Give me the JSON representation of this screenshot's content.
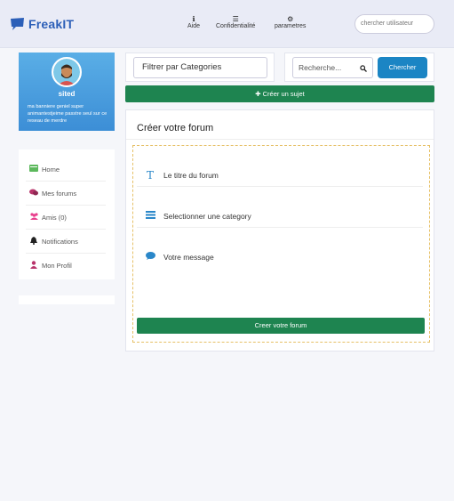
{
  "brand": {
    "name": "FreakIT",
    "color": "#2c5fb8"
  },
  "nav": {
    "items": [
      {
        "icon": "info-icon",
        "label": "Aide"
      },
      {
        "icon": "list-icon",
        "label": "Confidentialité"
      },
      {
        "icon": "gear-icon",
        "label": "parametres"
      }
    ],
    "user_search_placeholder": "chercher utilisateur"
  },
  "profile": {
    "name": "sited",
    "bio": "ma banniere geniel super animantestjeime passtre seul sur ce reseau de merdre"
  },
  "sidebar": {
    "items": [
      {
        "icon": "home-icon",
        "label": "Home"
      },
      {
        "icon": "comments-icon",
        "label": "Mes forums"
      },
      {
        "icon": "users-icon",
        "label": "Amis (0)"
      },
      {
        "icon": "bell-icon",
        "label": "Notifications"
      },
      {
        "icon": "user-icon",
        "label": "Mon Profil"
      }
    ]
  },
  "toolbar": {
    "filter_placeholder": "Filtrer par Categories",
    "search_placeholder": "Recherche...",
    "search_button": "Chercher",
    "create_topic": "✚ Créer un sujet"
  },
  "forum_form": {
    "heading": "Créer votre forum",
    "title_placeholder": "Le titre du forum",
    "category_placeholder": "Selectionner une category",
    "message_placeholder": "Votre message",
    "submit_label": "Creer votre forum"
  },
  "colors": {
    "primary": "#1b85c4",
    "success": "#1e8450",
    "profile_gradient_top": "#5aaee6",
    "profile_gradient_bottom": "#3c8ed6",
    "dashed_border": "#e6c066"
  }
}
